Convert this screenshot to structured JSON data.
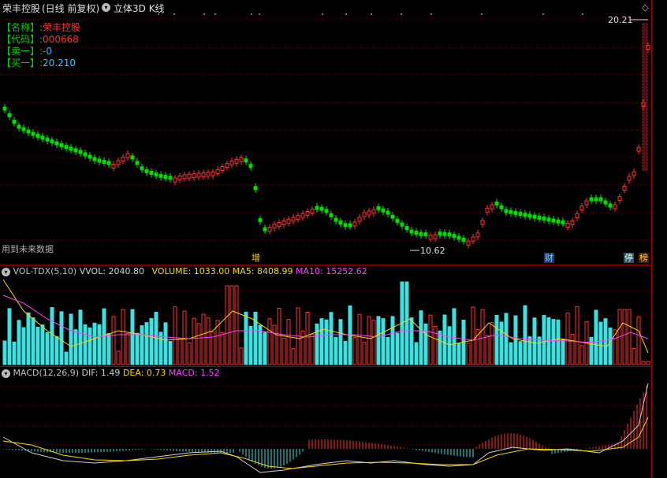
{
  "header": {
    "stock_title": "荣丰控股",
    "period_label": "(日线 前复权)",
    "view_mode": "立体3D K线"
  },
  "info": [
    {
      "label": "【名称】:",
      "value": "荣丰控股",
      "color": "#ff3030"
    },
    {
      "label": "【代码】:",
      "value": "000668",
      "color": "#ff3030"
    },
    {
      "label": "【卖一】:",
      "value": "-0",
      "color": "#30a8ff"
    },
    {
      "label": "【买一】:",
      "value": "20.210",
      "color": "#30c8ff"
    }
  ],
  "price_panel": {
    "high_label": "20.21",
    "low_label": "10.62",
    "future_data_note": "用到未来数据",
    "event_tags": [
      {
        "text": "增",
        "color": "#ffd700",
        "bg": "#000"
      },
      {
        "text": "财",
        "color": "#8cc8ff",
        "bg": "#1a3a6a"
      },
      {
        "text": "停",
        "color": "#ffffff",
        "bg": "#1a5a6a"
      },
      {
        "text": "榜",
        "color": "#ffd700",
        "bg": "#4a1a00"
      }
    ]
  },
  "volume_panel": {
    "indicator": "VOL-TDX(5,10)",
    "vvol_label": "VVOL: 2040.80",
    "volume_label": "VOLUME: 1033.00",
    "ma5_label": "MA5: 8408.99",
    "ma10_label": "MA10: 15252.62",
    "colors": {
      "vvol": "#d0d0d0",
      "volume": "#ffd700",
      "ma5": "#ffd700",
      "ma10": "#ff40ff"
    }
  },
  "macd_panel": {
    "indicator": "MACD(12,26,9)",
    "dif_label": "DIF: 1.49",
    "dea_label": "DEA: 0.73",
    "macd_label": "MACD: 1.52",
    "colors": {
      "dif": "#d0d0d0",
      "dea": "#ffd700",
      "macd": "#ff40ff"
    }
  },
  "colors": {
    "up": "#ff3030",
    "down": "#00e000",
    "grid": "#7a0000",
    "cyan": "#40e0e0"
  }
}
